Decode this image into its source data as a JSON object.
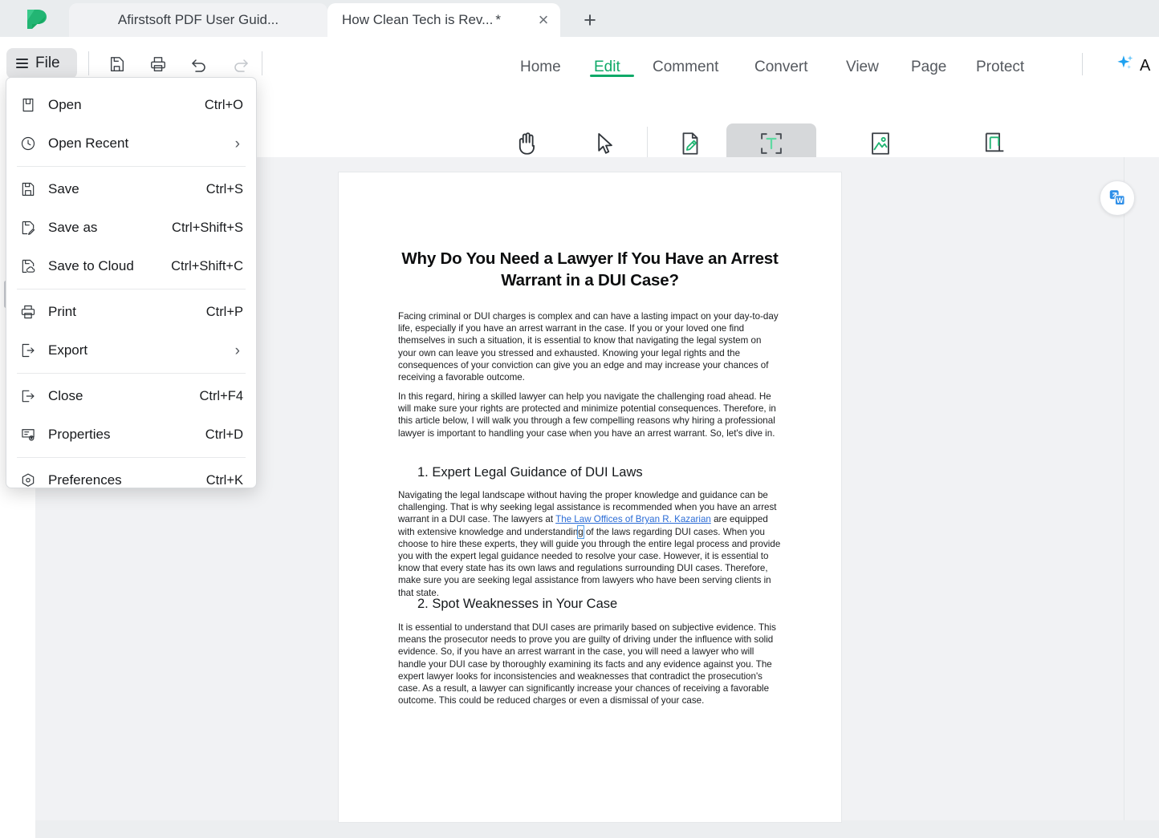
{
  "app": {
    "logo_icon": "afirstsoft-leaf-logo",
    "accent_green": "#0fa968",
    "progress_blue": "#1273d0"
  },
  "tabs": {
    "items": [
      {
        "title": "Afirstsoft PDF User Guid...",
        "active": false,
        "dirty": ""
      },
      {
        "title": "How Clean Tech is Rev...",
        "active": true,
        "dirty": "*"
      }
    ],
    "close_icon": "×",
    "new_tab_icon": "+"
  },
  "toolbar": {
    "file_label": "File",
    "quick_actions": [
      {
        "name": "save-icon",
        "label": "Save"
      },
      {
        "name": "print-icon",
        "label": "Print"
      },
      {
        "name": "undo-icon",
        "label": "Undo"
      },
      {
        "name": "redo-icon",
        "label": "Redo"
      }
    ]
  },
  "ribbon": {
    "menus": [
      {
        "label": "Home",
        "selected": false
      },
      {
        "label": "Edit",
        "selected": true
      },
      {
        "label": "Comment",
        "selected": false
      },
      {
        "label": "Convert",
        "selected": false
      },
      {
        "label": "View",
        "selected": false
      },
      {
        "label": "Page",
        "selected": false
      },
      {
        "label": "Protect",
        "selected": false
      }
    ],
    "ai_label": "A",
    "ai_icon": "sparkle-icon",
    "tools": [
      {
        "label": "Hand",
        "icon": "hand-icon",
        "active": false
      },
      {
        "label": "Select",
        "icon": "cursor-arrow-icon",
        "active": false
      },
      {
        "label": "Edit",
        "icon": "edit-pencil-page-icon",
        "active": false
      },
      {
        "label": "Add Text",
        "icon": "add-text-icon",
        "active": true
      },
      {
        "label": "Add Image",
        "icon": "add-image-icon",
        "active": false
      },
      {
        "label": "Crop Page",
        "icon": "crop-page-icon",
        "active": false
      }
    ]
  },
  "file_menu": {
    "groups": [
      [
        {
          "label": "Open",
          "accel": "Ctrl+O",
          "icon": "open-file-icon",
          "submenu": false
        },
        {
          "label": "Open Recent",
          "accel": "",
          "icon": "clock-icon",
          "submenu": true
        }
      ],
      [
        {
          "label": "Save",
          "accel": "Ctrl+S",
          "icon": "floppy-save-icon",
          "submenu": false
        },
        {
          "label": "Save as",
          "accel": "Ctrl+Shift+S",
          "icon": "save-as-pencil-icon",
          "submenu": false
        },
        {
          "label": "Save to Cloud",
          "accel": "Ctrl+Shift+C",
          "icon": "save-cloud-icon",
          "submenu": false
        }
      ],
      [
        {
          "label": "Print",
          "accel": "Ctrl+P",
          "icon": "printer-icon",
          "submenu": false
        },
        {
          "label": "Export",
          "accel": "",
          "icon": "export-arrow-icon",
          "submenu": true
        }
      ],
      [
        {
          "label": "Close",
          "accel": "Ctrl+F4",
          "icon": "close-arrow-icon",
          "submenu": false
        },
        {
          "label": "Properties",
          "accel": "Ctrl+D",
          "icon": "properties-icon",
          "submenu": false
        }
      ],
      [
        {
          "label": "Preferences",
          "accel": "Ctrl+K",
          "icon": "preferences-gear-icon",
          "submenu": false
        }
      ]
    ],
    "submenu_arrow": "›"
  },
  "document": {
    "title": "Why Do You Need a Lawyer If You Have an Arrest Warrant in a DUI Case?",
    "paragraph1": "Facing criminal or DUI charges is complex and can have a lasting impact on your day-to-day life, especially if you have an arrest warrant in the case. If you or your loved one find themselves in such a situation, it is essential to know that navigating the legal system on your own can leave you stressed and exhausted. Knowing your legal rights and the consequences of your conviction can give you an edge and may increase your chances of receiving a favorable outcome.",
    "paragraph2": "In this regard, hiring a skilled lawyer can help you navigate the challenging road ahead. He will make sure your rights are protected and minimize potential consequences. Therefore, in this article below, I will walk you through a few compelling reasons why hiring a professional lawyer is important to handling your case when you have an arrest warrant. So, let's dive in.",
    "heading1": "1. Expert Legal Guidance of DUI Laws",
    "section1_before_link": "Navigating the legal landscape without having the proper knowledge and guidance can be challenging. That is why seeking legal assistance is recommended when you have an arrest warrant in a DUI case. The lawyers at ",
    "section1_link": "The Law Offices of Bryan R. Kazarian",
    "section1_after_link_a": " are equipped with extensive knowledge and understandin",
    "section1_caret_char": "g",
    "section1_after_link_b": " of the laws regarding DUI cases. When you choose to hire these experts, they will guide you through the entire legal process and provide you with the expert legal guidance needed to resolve your case. However, it is essential to know that every state has its own laws and regulations surrounding DUI cases. Therefore, make sure you are seeking legal assistance from lawyers who have been serving clients in that state.",
    "heading2": "2. Spot Weaknesses in Your Case",
    "section2": "It is essential to understand that DUI cases are primarily based on subjective evidence. This means the prosecutor needs to prove you are guilty of driving under the influence with solid evidence. So, if you have an arrest warrant in the case, you will need a lawyer who will handle your DUI case by thoroughly examining its facts and any evidence against you. The expert lawyer looks for inconsistencies and weaknesses that contradict the prosecution's case. As a result, a lawyer can significantly increase your chances of receiving a favorable outcome. This could be reduced charges or even a dismissal of your case.",
    "convert_float_icon": "pdf-to-word-icon"
  }
}
